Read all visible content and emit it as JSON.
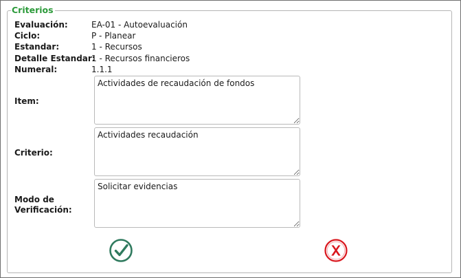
{
  "panel": {
    "legend": "Criterios"
  },
  "fields": {
    "evaluacion": {
      "label": "Evaluación:",
      "value": "EA-01 - Autoevaluación"
    },
    "ciclo": {
      "label": "Ciclo:",
      "value": "P - Planear"
    },
    "estandar": {
      "label": "Estandar:",
      "value": "1 - Recursos"
    },
    "detalle_estandar": {
      "label": "Detalle Estandar:",
      "value": "1 - Recursos financieros"
    },
    "numeral": {
      "label": "Numeral:",
      "value": "1.1.1"
    }
  },
  "item": {
    "label": "Item:",
    "value": "Actividades de recaudación de fondos"
  },
  "criterio": {
    "label": "Criterio:",
    "value": "Actividades recaudación"
  },
  "modo_verificacion": {
    "label": "Modo de Verificación:",
    "value": "Solicitar evidencias"
  },
  "actions": {
    "accept_icon": "check-circle-icon",
    "cancel_icon": "x-circle-icon",
    "accept_color": "#2f7a5e",
    "cancel_color": "#d9161d"
  }
}
